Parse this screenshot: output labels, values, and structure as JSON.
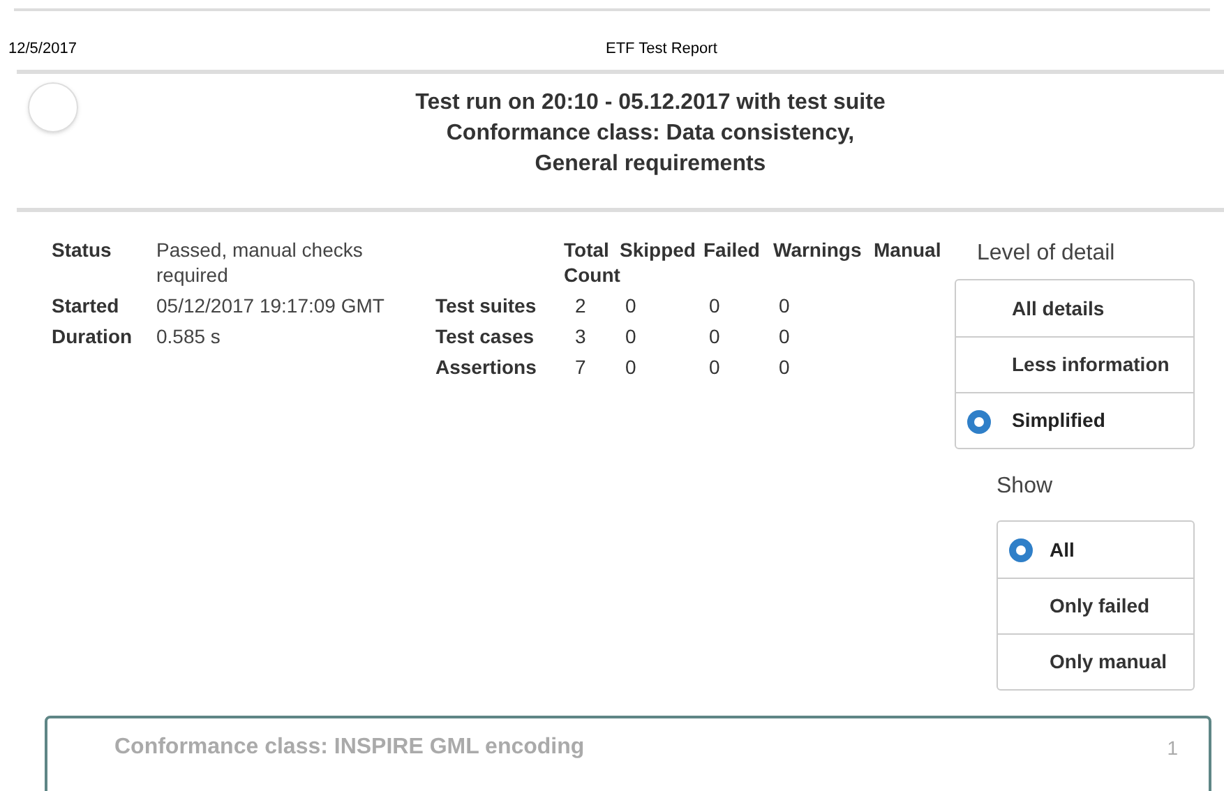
{
  "print_header": {
    "date": "12/5/2017",
    "title": "ETF Test Report"
  },
  "report_title": "Test run on 20:10 - 05.12.2017 with test suite Conformance class: Data consistency, General requirements",
  "summary": [
    {
      "label": "Status",
      "value": "Passed, manual checks required"
    },
    {
      "label": "Started",
      "value": "05/12/2017 19:17:09 GMT"
    },
    {
      "label": "Duration",
      "value": "0.585 s"
    }
  ],
  "stats": {
    "columns": [
      "Total Count",
      "Skipped",
      "Failed",
      "Warnings",
      "Manual"
    ],
    "rows": [
      {
        "label": "Test suites",
        "values": [
          "2",
          "0",
          "0",
          "0"
        ]
      },
      {
        "label": "Test cases",
        "values": [
          "3",
          "0",
          "0",
          "0"
        ]
      },
      {
        "label": "Assertions",
        "values": [
          "7",
          "0",
          "0",
          "0"
        ]
      }
    ]
  },
  "level_of_detail": {
    "title": "Level of detail",
    "options": [
      {
        "label": "All details",
        "selected": false
      },
      {
        "label": "Less information",
        "selected": false
      },
      {
        "label": "Simplified",
        "selected": true
      }
    ]
  },
  "show": {
    "title": "Show",
    "options": [
      {
        "label": "All",
        "selected": true
      },
      {
        "label": "Only failed",
        "selected": false
      },
      {
        "label": "Only manual",
        "selected": false
      }
    ]
  },
  "test_suites": [
    {
      "name": "Conformance class: INSPIRE GML encoding",
      "count": "1"
    }
  ]
}
